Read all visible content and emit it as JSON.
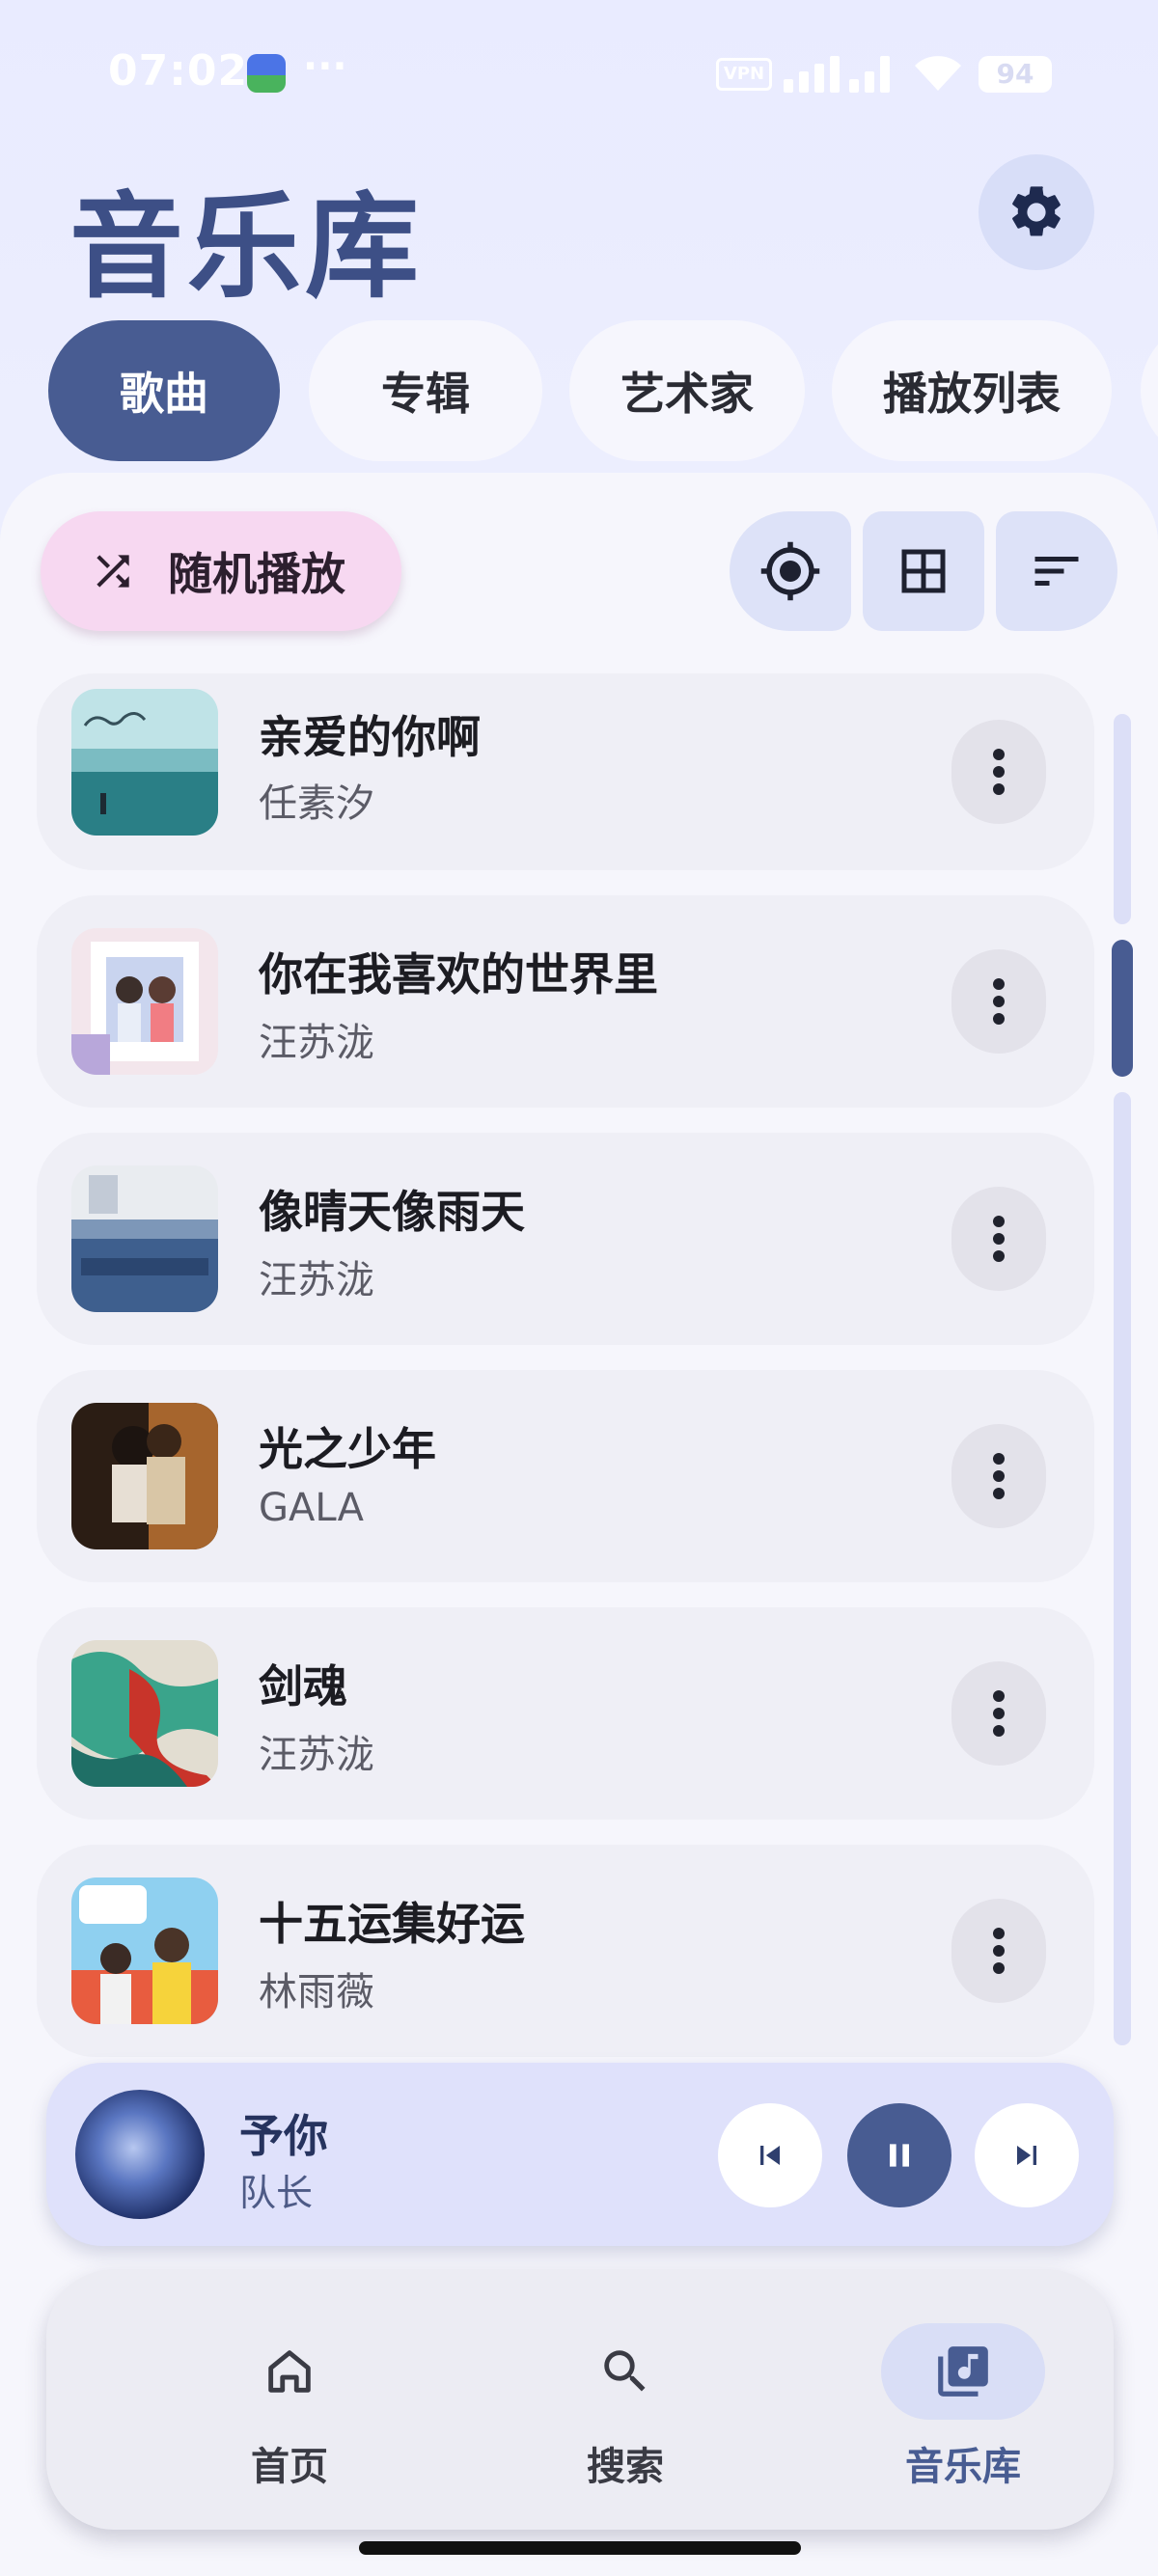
{
  "status_bar": {
    "time": "07:02",
    "dots": "···",
    "vpn": "VPN",
    "battery": "94"
  },
  "header": {
    "title": "音乐库",
    "settings_icon": "gear-icon"
  },
  "tabs": [
    {
      "label": "歌曲",
      "active": true
    },
    {
      "label": "专辑",
      "active": false
    },
    {
      "label": "艺术家",
      "active": false
    },
    {
      "label": "播放列表",
      "active": false
    }
  ],
  "toolbar": {
    "shuffle_label": "随机播放",
    "shuffle_icon": "shuffle-icon",
    "locate_icon": "locate-icon",
    "grid_icon": "grid-view-icon",
    "sort_icon": "sort-icon"
  },
  "songs": [
    {
      "title": "亲爱的你啊",
      "artist": "任素汐"
    },
    {
      "title": "你在我喜欢的世界里",
      "artist": "汪苏泷"
    },
    {
      "title": "像晴天像雨天",
      "artist": "汪苏泷"
    },
    {
      "title": "光之少年",
      "artist": "GALA"
    },
    {
      "title": "剑魂",
      "artist": "汪苏泷"
    },
    {
      "title": "十五运集好运",
      "artist": "林雨薇"
    }
  ],
  "now_playing": {
    "title": "予你",
    "artist": "队长",
    "state": "playing"
  },
  "bottom_nav": [
    {
      "label": "首页",
      "icon": "home-icon",
      "active": false
    },
    {
      "label": "搜索",
      "icon": "search-icon",
      "active": false
    },
    {
      "label": "音乐库",
      "icon": "library-music-icon",
      "active": true
    }
  ],
  "colors": {
    "accent": "#485c92",
    "title": "#3d4f86",
    "shuffle_bg": "#f7d8f1",
    "surface": "#efeff6"
  }
}
